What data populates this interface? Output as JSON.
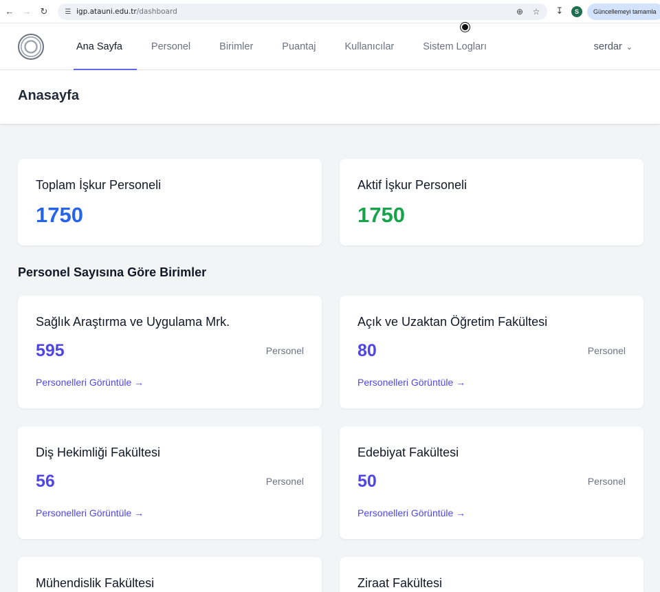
{
  "browser": {
    "url_host": "igp.atauni.edu.tr",
    "url_path": "/dashboard",
    "profile_initial": "S",
    "update_label": "Güncellemeyi tamamla"
  },
  "header": {
    "nav": [
      {
        "label": "Ana Sayfa",
        "active": true
      },
      {
        "label": "Personel"
      },
      {
        "label": "Birimler"
      },
      {
        "label": "Puantaj"
      },
      {
        "label": "Kullanıcılar"
      },
      {
        "label": "Sistem Logları"
      }
    ],
    "user": "serdar"
  },
  "page": {
    "title": "Anasayfa"
  },
  "stats": {
    "total": {
      "label": "Toplam İşkur Personeli",
      "value": "1750",
      "color": "#2563eb"
    },
    "active": {
      "label": "Aktif İşkur Personeli",
      "value": "1750",
      "color": "#16a34a"
    }
  },
  "units_section": {
    "title": "Personel Sayısına Göre Birimler",
    "suffix": "Personel",
    "link_label": "Personelleri Görüntüle →",
    "items": [
      {
        "name": "Sağlık Araştırma ve Uygulama Mrk.",
        "count": "595"
      },
      {
        "name": "Açık ve Uzaktan Öğretim Fakültesi",
        "count": "80"
      },
      {
        "name": "Diş Hekimliği Fakültesi",
        "count": "56"
      },
      {
        "name": "Edebiyat Fakültesi",
        "count": "50"
      },
      {
        "name": "Mühendislik Fakültesi",
        "count": ""
      },
      {
        "name": "Ziraat Fakültesi",
        "count": ""
      }
    ]
  }
}
